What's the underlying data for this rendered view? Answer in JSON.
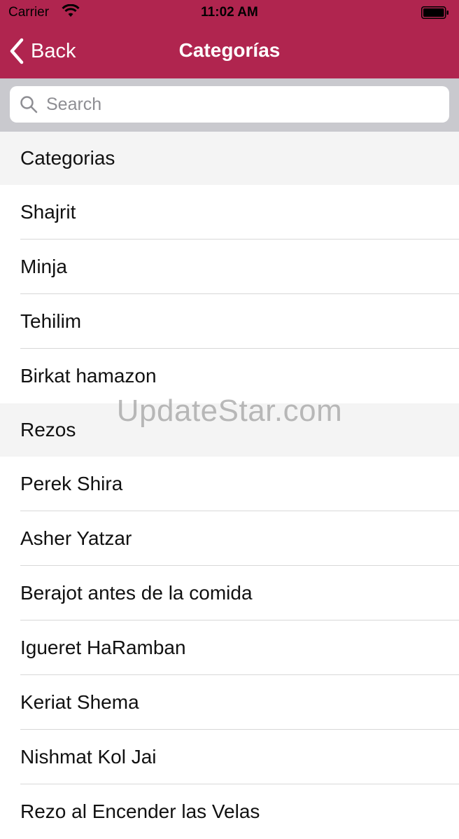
{
  "status_bar": {
    "carrier": "Carrier",
    "time": "11:02 AM"
  },
  "nav": {
    "back_label": "Back",
    "title": "Categorías"
  },
  "search": {
    "placeholder": "Search"
  },
  "sections": [
    {
      "header": "Categorias",
      "items": [
        "Shajrit",
        "Minja",
        "Tehilim",
        "Birkat hamazon"
      ]
    },
    {
      "header": "Rezos",
      "items": [
        "Perek Shira",
        "Asher Yatzar",
        "Berajot antes de la comida",
        "Igueret HaRamban",
        "Keriat Shema",
        "Nishmat Kol Jai",
        "Rezo al Encender las Velas"
      ]
    }
  ],
  "watermark": "UpdateStar.com",
  "colors": {
    "accent": "#b0254f",
    "search_bar_bg": "#c9c9ce",
    "section_bg": "#f4f4f4"
  }
}
